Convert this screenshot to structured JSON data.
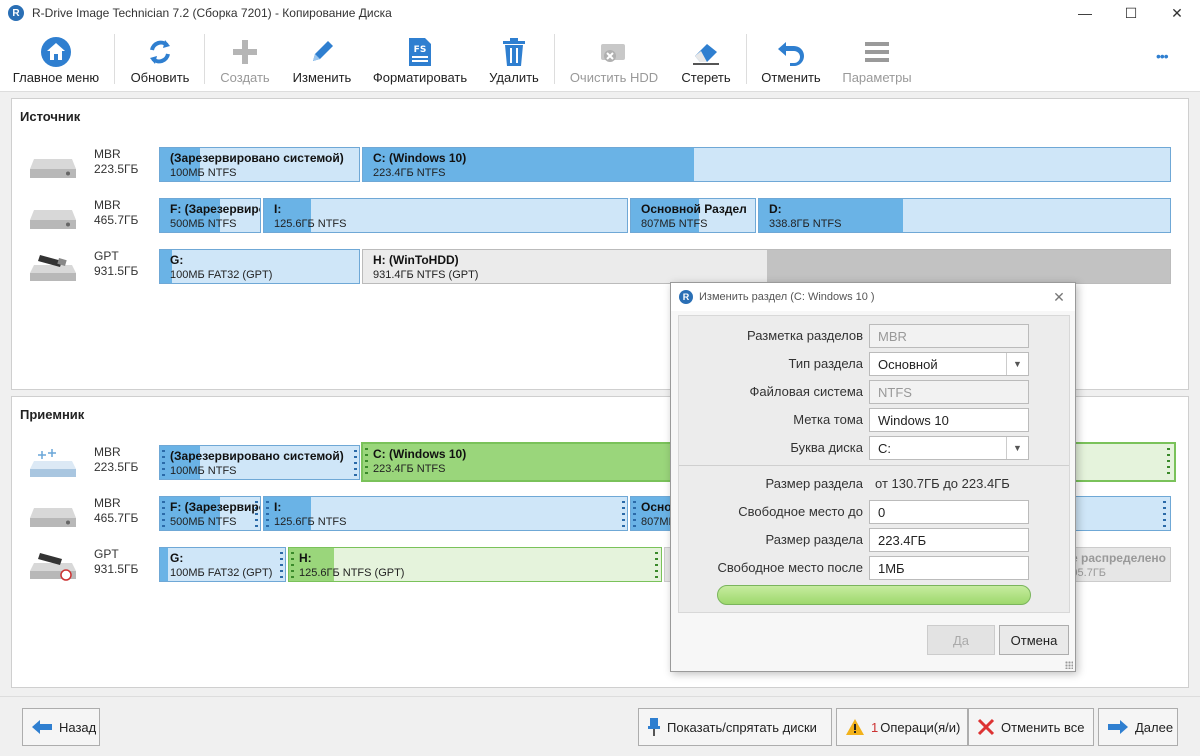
{
  "window": {
    "title": "R-Drive Image Technician 7.2 (Сборка 7201) - Копирование Диска",
    "app_icon_letter": "R",
    "minimize": "—",
    "maximize": "☐",
    "close": "✕"
  },
  "toolbar": {
    "main_menu": "Главное меню",
    "refresh": "Обновить",
    "create": "Создать",
    "edit": "Изменить",
    "format": "Форматировать",
    "delete": "Удалить",
    "clear_hdd": "Очистить HDD",
    "erase": "Стереть",
    "undo": "Отменить",
    "params": "Параметры",
    "more": "•••"
  },
  "source": {
    "title": "Источник",
    "disks": [
      {
        "style": "MBR",
        "size": "223.5ГБ",
        "parts": [
          {
            "name": "(Зарезервировано системой)",
            "info": "100МБ NTFS"
          },
          {
            "name": "C: (Windows 10)",
            "info": "223.4ГБ NTFS"
          }
        ]
      },
      {
        "style": "MBR",
        "size": "465.7ГБ",
        "parts": [
          {
            "name": "F: (Зарезервировано системой)",
            "info": "500МБ NTFS"
          },
          {
            "name": "I:",
            "info": "125.6ГБ NTFS"
          },
          {
            "name": "Основной Раздел",
            "info": "807МБ NTFS"
          },
          {
            "name": "D:",
            "info": "338.8ГБ NTFS"
          }
        ]
      },
      {
        "style": "GPT",
        "size": "931.5ГБ",
        "parts": [
          {
            "name": "G:",
            "info": "100МБ FAT32 (GPT)"
          },
          {
            "name": "H: (WinToHDD)",
            "info": "931.4ГБ NTFS (GPT)"
          }
        ]
      }
    ]
  },
  "target": {
    "title": "Приемник",
    "disks": [
      {
        "style": "MBR",
        "size": "223.5ГБ",
        "parts": [
          {
            "name": "(Зарезервировано системой)",
            "info": "100МБ NTFS"
          },
          {
            "name": "C: (Windows 10)",
            "info": "223.4ГБ NTFS"
          }
        ]
      },
      {
        "style": "MBR",
        "size": "465.7ГБ",
        "parts": [
          {
            "name": "F: (Зарезервировано системой)",
            "info": "500МБ NTFS"
          },
          {
            "name": "I:",
            "info": "125.6ГБ NTFS"
          },
          {
            "name": "Основной Раздел",
            "info": "807МБ NTFS"
          }
        ]
      },
      {
        "style": "GPT",
        "size": "931.5ГБ",
        "parts": [
          {
            "name": "G:",
            "info": "100МБ FAT32 (GPT)"
          },
          {
            "name": "H:",
            "info": "125.6ГБ NTFS (GPT)"
          },
          {
            "name": "Не распределено",
            "info": "805.7ГБ"
          }
        ]
      }
    ]
  },
  "dialog": {
    "title": "Изменить раздел (C: Windows 10 )",
    "close": "✕",
    "fields": {
      "partition_scheme_label": "Разметка разделов",
      "partition_scheme_value": "MBR",
      "partition_type_label": "Тип раздела",
      "partition_type_value": "Основной",
      "filesystem_label": "Файловая система",
      "filesystem_value": "NTFS",
      "volume_label_label": "Метка тома",
      "volume_label_value": "Windows 10",
      "drive_letter_label": "Буква диска",
      "drive_letter_value": "C:",
      "size_range_label": "Размер раздела",
      "size_range_text": "от  130.7ГБ  до  223.4ГБ",
      "free_before_label": "Свободное место до",
      "free_before_value": "0",
      "size_label": "Размер раздела",
      "size_value": "223.4ГБ",
      "free_after_label": "Свободное место после",
      "free_after_value": "1МБ"
    },
    "ok": "Да",
    "cancel": "Отмена"
  },
  "bottom": {
    "back": "Назад",
    "show_hide": "Показать/спрятать диски",
    "ops_count": "1",
    "ops": "Операци(я/и)",
    "cancel_all": "Отменить все",
    "next": "Далее"
  }
}
